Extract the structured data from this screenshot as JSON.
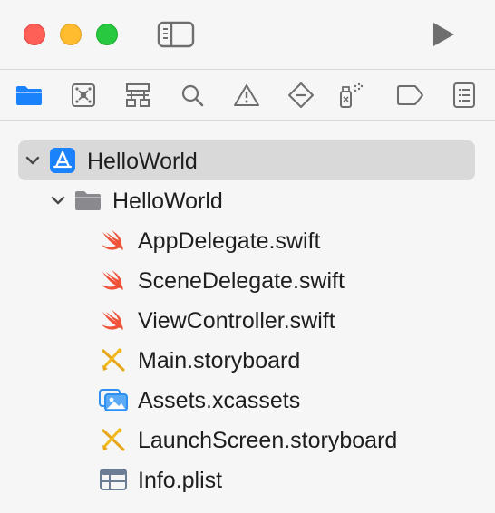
{
  "window": {
    "controls": [
      "close",
      "minimize",
      "zoom"
    ],
    "toolbar": {
      "sidebar_toggle_icon": "sidebar-left-icon",
      "run_icon": "play-icon"
    }
  },
  "navigator_tabs": [
    {
      "name": "project-navigator",
      "icon": "folder-icon",
      "active": true
    },
    {
      "name": "source-control-navigator",
      "icon": "source-control-icon",
      "active": false
    },
    {
      "name": "symbol-navigator",
      "icon": "hierarchy-icon",
      "active": false
    },
    {
      "name": "find-navigator",
      "icon": "search-icon",
      "active": false
    },
    {
      "name": "issue-navigator",
      "icon": "warning-icon",
      "active": false
    },
    {
      "name": "test-navigator",
      "icon": "diamond-minus-icon",
      "active": false
    },
    {
      "name": "debug-navigator",
      "icon": "spray-can-icon",
      "active": false
    },
    {
      "name": "breakpoint-navigator",
      "icon": "breakpoint-tag-icon",
      "active": false
    },
    {
      "name": "report-navigator",
      "icon": "list-icon",
      "active": false
    }
  ],
  "accent_color": "#1a82fb",
  "tree": {
    "project": {
      "label": "HelloWorld",
      "icon": "app-project-icon",
      "expanded": true,
      "selected": true
    },
    "group": {
      "label": "HelloWorld",
      "icon": "folder-icon",
      "expanded": true
    },
    "files": [
      {
        "label": "AppDelegate.swift",
        "icon": "swift-icon"
      },
      {
        "label": "SceneDelegate.swift",
        "icon": "swift-icon"
      },
      {
        "label": "ViewController.swift",
        "icon": "swift-icon"
      },
      {
        "label": "Main.storyboard",
        "icon": "storyboard-icon"
      },
      {
        "label": "Assets.xcassets",
        "icon": "assets-icon"
      },
      {
        "label": "LaunchScreen.storyboard",
        "icon": "storyboard-icon"
      },
      {
        "label": "Info.plist",
        "icon": "plist-icon"
      }
    ]
  }
}
